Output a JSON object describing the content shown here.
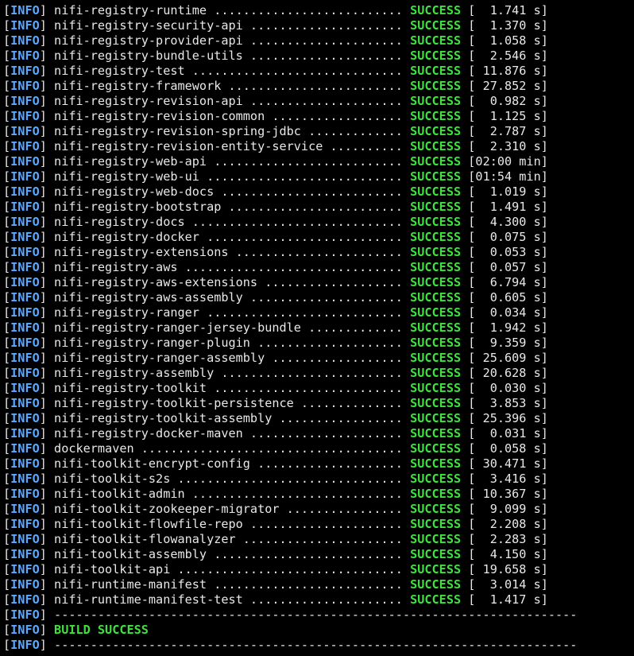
{
  "theme": {
    "background": "#000000",
    "text": "#e8e8e8",
    "info_color": "#5aa9ff",
    "success_color": "#3fe03f"
  },
  "level": "INFO",
  "reactor_rows": [
    {
      "module": "nifi-registry-runtime ..........................",
      "status": "SUCCESS",
      "time": "[  1.741 s]"
    },
    {
      "module": "nifi-registry-security-api .....................",
      "status": "SUCCESS",
      "time": "[  1.370 s]"
    },
    {
      "module": "nifi-registry-provider-api .....................",
      "status": "SUCCESS",
      "time": "[  1.058 s]"
    },
    {
      "module": "nifi-registry-bundle-utils .....................",
      "status": "SUCCESS",
      "time": "[  2.546 s]"
    },
    {
      "module": "nifi-registry-test .............................",
      "status": "SUCCESS",
      "time": "[ 11.876 s]"
    },
    {
      "module": "nifi-registry-framework ........................",
      "status": "SUCCESS",
      "time": "[ 27.852 s]"
    },
    {
      "module": "nifi-registry-revision-api .....................",
      "status": "SUCCESS",
      "time": "[  0.982 s]"
    },
    {
      "module": "nifi-registry-revision-common ..................",
      "status": "SUCCESS",
      "time": "[  1.125 s]"
    },
    {
      "module": "nifi-registry-revision-spring-jdbc .............",
      "status": "SUCCESS",
      "time": "[  2.787 s]"
    },
    {
      "module": "nifi-registry-revision-entity-service ..........",
      "status": "SUCCESS",
      "time": "[  2.310 s]"
    },
    {
      "module": "nifi-registry-web-api ..........................",
      "status": "SUCCESS",
      "time": "[02:00 min]"
    },
    {
      "module": "nifi-registry-web-ui ...........................",
      "status": "SUCCESS",
      "time": "[01:54 min]"
    },
    {
      "module": "nifi-registry-web-docs .........................",
      "status": "SUCCESS",
      "time": "[  1.019 s]"
    },
    {
      "module": "nifi-registry-bootstrap ........................",
      "status": "SUCCESS",
      "time": "[  1.491 s]"
    },
    {
      "module": "nifi-registry-docs .............................",
      "status": "SUCCESS",
      "time": "[  4.300 s]"
    },
    {
      "module": "nifi-registry-docker ...........................",
      "status": "SUCCESS",
      "time": "[  0.075 s]"
    },
    {
      "module": "nifi-registry-extensions .......................",
      "status": "SUCCESS",
      "time": "[  0.053 s]"
    },
    {
      "module": "nifi-registry-aws ..............................",
      "status": "SUCCESS",
      "time": "[  0.057 s]"
    },
    {
      "module": "nifi-registry-aws-extensions ...................",
      "status": "SUCCESS",
      "time": "[  6.794 s]"
    },
    {
      "module": "nifi-registry-aws-assembly .....................",
      "status": "SUCCESS",
      "time": "[  0.605 s]"
    },
    {
      "module": "nifi-registry-ranger ...........................",
      "status": "SUCCESS",
      "time": "[  0.034 s]"
    },
    {
      "module": "nifi-registry-ranger-jersey-bundle .............",
      "status": "SUCCESS",
      "time": "[  1.942 s]"
    },
    {
      "module": "nifi-registry-ranger-plugin ....................",
      "status": "SUCCESS",
      "time": "[  9.359 s]"
    },
    {
      "module": "nifi-registry-ranger-assembly ..................",
      "status": "SUCCESS",
      "time": "[ 25.609 s]"
    },
    {
      "module": "nifi-registry-assembly .........................",
      "status": "SUCCESS",
      "time": "[ 20.628 s]"
    },
    {
      "module": "nifi-registry-toolkit ..........................",
      "status": "SUCCESS",
      "time": "[  0.030 s]"
    },
    {
      "module": "nifi-registry-toolkit-persistence ..............",
      "status": "SUCCESS",
      "time": "[  3.853 s]"
    },
    {
      "module": "nifi-registry-toolkit-assembly .................",
      "status": "SUCCESS",
      "time": "[ 25.396 s]"
    },
    {
      "module": "nifi-registry-docker-maven .....................",
      "status": "SUCCESS",
      "time": "[  0.031 s]"
    },
    {
      "module": "dockermaven ....................................",
      "status": "SUCCESS",
      "time": "[  0.058 s]"
    },
    {
      "module": "nifi-toolkit-encrypt-config ....................",
      "status": "SUCCESS",
      "time": "[ 30.471 s]"
    },
    {
      "module": "nifi-toolkit-s2s ...............................",
      "status": "SUCCESS",
      "time": "[  3.416 s]"
    },
    {
      "module": "nifi-toolkit-admin .............................",
      "status": "SUCCESS",
      "time": "[ 10.367 s]"
    },
    {
      "module": "nifi-toolkit-zookeeper-migrator ................",
      "status": "SUCCESS",
      "time": "[  9.099 s]"
    },
    {
      "module": "nifi-toolkit-flowfile-repo .....................",
      "status": "SUCCESS",
      "time": "[  2.208 s]"
    },
    {
      "module": "nifi-toolkit-flowanalyzer ......................",
      "status": "SUCCESS",
      "time": "[  2.283 s]"
    },
    {
      "module": "nifi-toolkit-assembly ..........................",
      "status": "SUCCESS",
      "time": "[  4.150 s]"
    },
    {
      "module": "nifi-toolkit-api ...............................",
      "status": "SUCCESS",
      "time": "[ 19.658 s]"
    },
    {
      "module": "nifi-runtime-manifest ..........................",
      "status": "SUCCESS",
      "time": "[  3.014 s]"
    },
    {
      "module": "nifi-runtime-manifest-test .....................",
      "status": "SUCCESS",
      "time": "[  1.417 s]"
    }
  ],
  "separator": "------------------------------------------------------------------------",
  "build_result": "BUILD SUCCESS"
}
